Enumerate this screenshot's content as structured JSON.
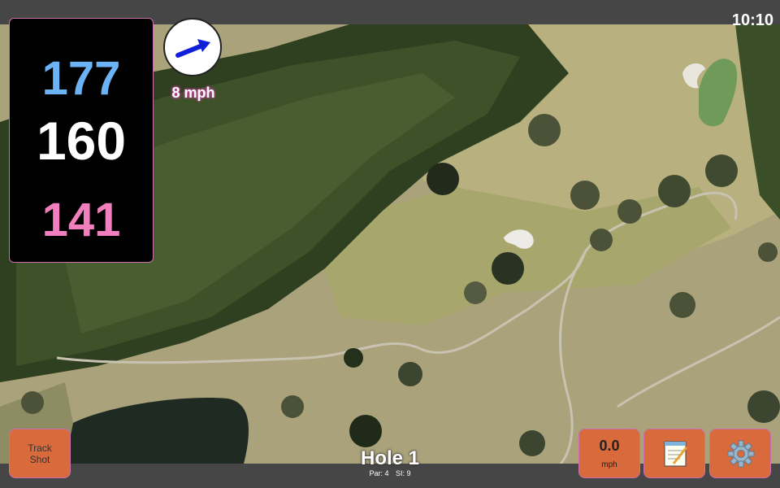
{
  "status": {
    "clock": "10:10"
  },
  "distances": {
    "back": "177",
    "middle": "160",
    "front": "141",
    "back_color": "#6cb3f5",
    "middle_color": "#ffffff",
    "front_color": "#f27fbd"
  },
  "wind": {
    "speed_label": "8 mph",
    "direction_icon": "arrow-icon",
    "arrow_color": "#1020d8"
  },
  "buttons": {
    "track_shot_line1": "Track",
    "track_shot_line2": "Shot",
    "speed_value": "0.0",
    "speed_unit": "mph",
    "notes_icon": "notepad-icon",
    "settings_icon": "gear-icon",
    "accent_color": "#d96a3c"
  },
  "hole": {
    "title": "Hole 1",
    "par_label": "Par: 4",
    "si_label": "SI: 9"
  },
  "map": {
    "type": "satellite-golf-course"
  }
}
